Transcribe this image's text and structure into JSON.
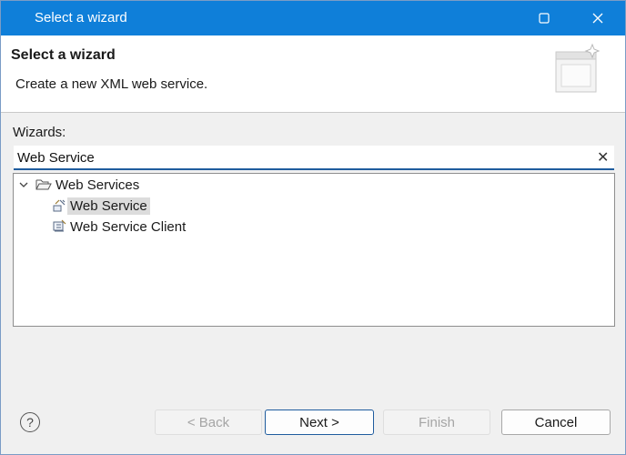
{
  "window": {
    "title": "Select a wizard"
  },
  "banner": {
    "heading": "Select a wizard",
    "description": "Create a new XML web service."
  },
  "wizards_label": "Wizards:",
  "filter": {
    "value": "Web Service"
  },
  "tree": {
    "category": {
      "label": "Web Services",
      "expanded": true
    },
    "items": [
      {
        "label": "Web Service",
        "selected": true
      },
      {
        "label": "Web Service Client",
        "selected": false
      }
    ]
  },
  "buttons": {
    "back": "< Back",
    "next": "Next >",
    "finish": "Finish",
    "cancel": "Cancel"
  },
  "help_glyph": "?",
  "icons": [
    "wizard-app-icon",
    "maximize-icon",
    "close-icon",
    "wizard-banner-icon",
    "clear-filter-icon",
    "collapse-chevron-icon",
    "folder-open-icon",
    "web-service-icon",
    "web-service-client-icon",
    "help-icon"
  ],
  "colors": {
    "titlebar": "#0f7fd9",
    "focus_border": "#1f5c9e",
    "selection": "#dcdcdc"
  }
}
